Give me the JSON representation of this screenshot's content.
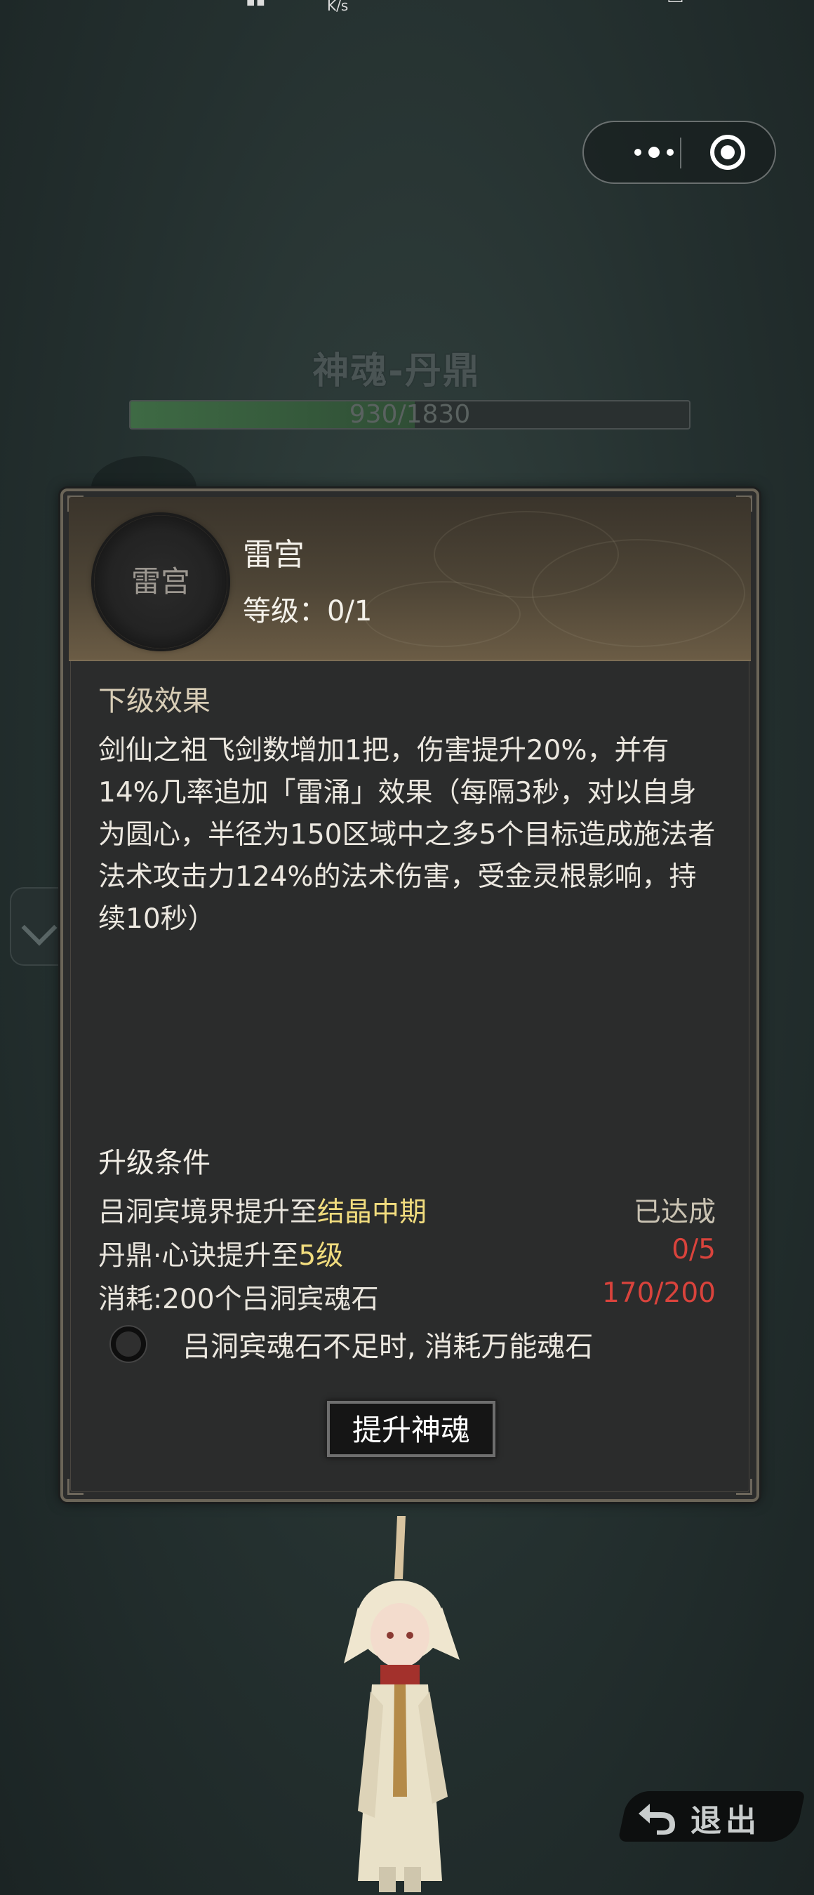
{
  "status_bar": {
    "speed_unit": "K/s"
  },
  "capsule": {
    "more_icon": "more-dots-icon",
    "close_icon": "target-close-icon"
  },
  "soul": {
    "title": "神魂-丹鼎",
    "progress_text": "930/1830",
    "progress_value": 930,
    "progress_max": 1830
  },
  "panel": {
    "emblem_label": "雷宫",
    "skill_name": "雷宫",
    "level_text": "等级：0/1",
    "next_effect_title": "下级效果",
    "next_effect_text": "剑仙之祖飞剑数增加1把，伤害提升20%，并有14%几率追加「雷涌」效果（每隔3秒，对以自身为圆心，半径为150区域中之多5个目标造成施法者法术攻击力124%的法术伤害，受金灵根影响，持续10秒）",
    "conditions_title": "升级条件",
    "conditions": [
      {
        "prefix": "吕洞宾境界提升至",
        "highlight": "结晶中期",
        "status": "已达成",
        "status_color": "#c9c2b2"
      },
      {
        "prefix": "丹鼎·心诀提升至",
        "highlight": "5级",
        "status": "0/5",
        "status_color": "#d9433c"
      },
      {
        "prefix": "消耗:200个吕洞宾魂石",
        "highlight": "",
        "status": "170/200",
        "status_color": "#d9433c"
      }
    ],
    "option_label": "吕洞宾魂石不足时, 消耗万能魂石",
    "upgrade_button": "提升神魂"
  },
  "exit_button": {
    "label": "退出",
    "icon": "return-arrow-icon"
  },
  "colors": {
    "highlight": "#f1dc7e",
    "section_title": "#d8cdb6",
    "insufficient": "#d9433c"
  }
}
